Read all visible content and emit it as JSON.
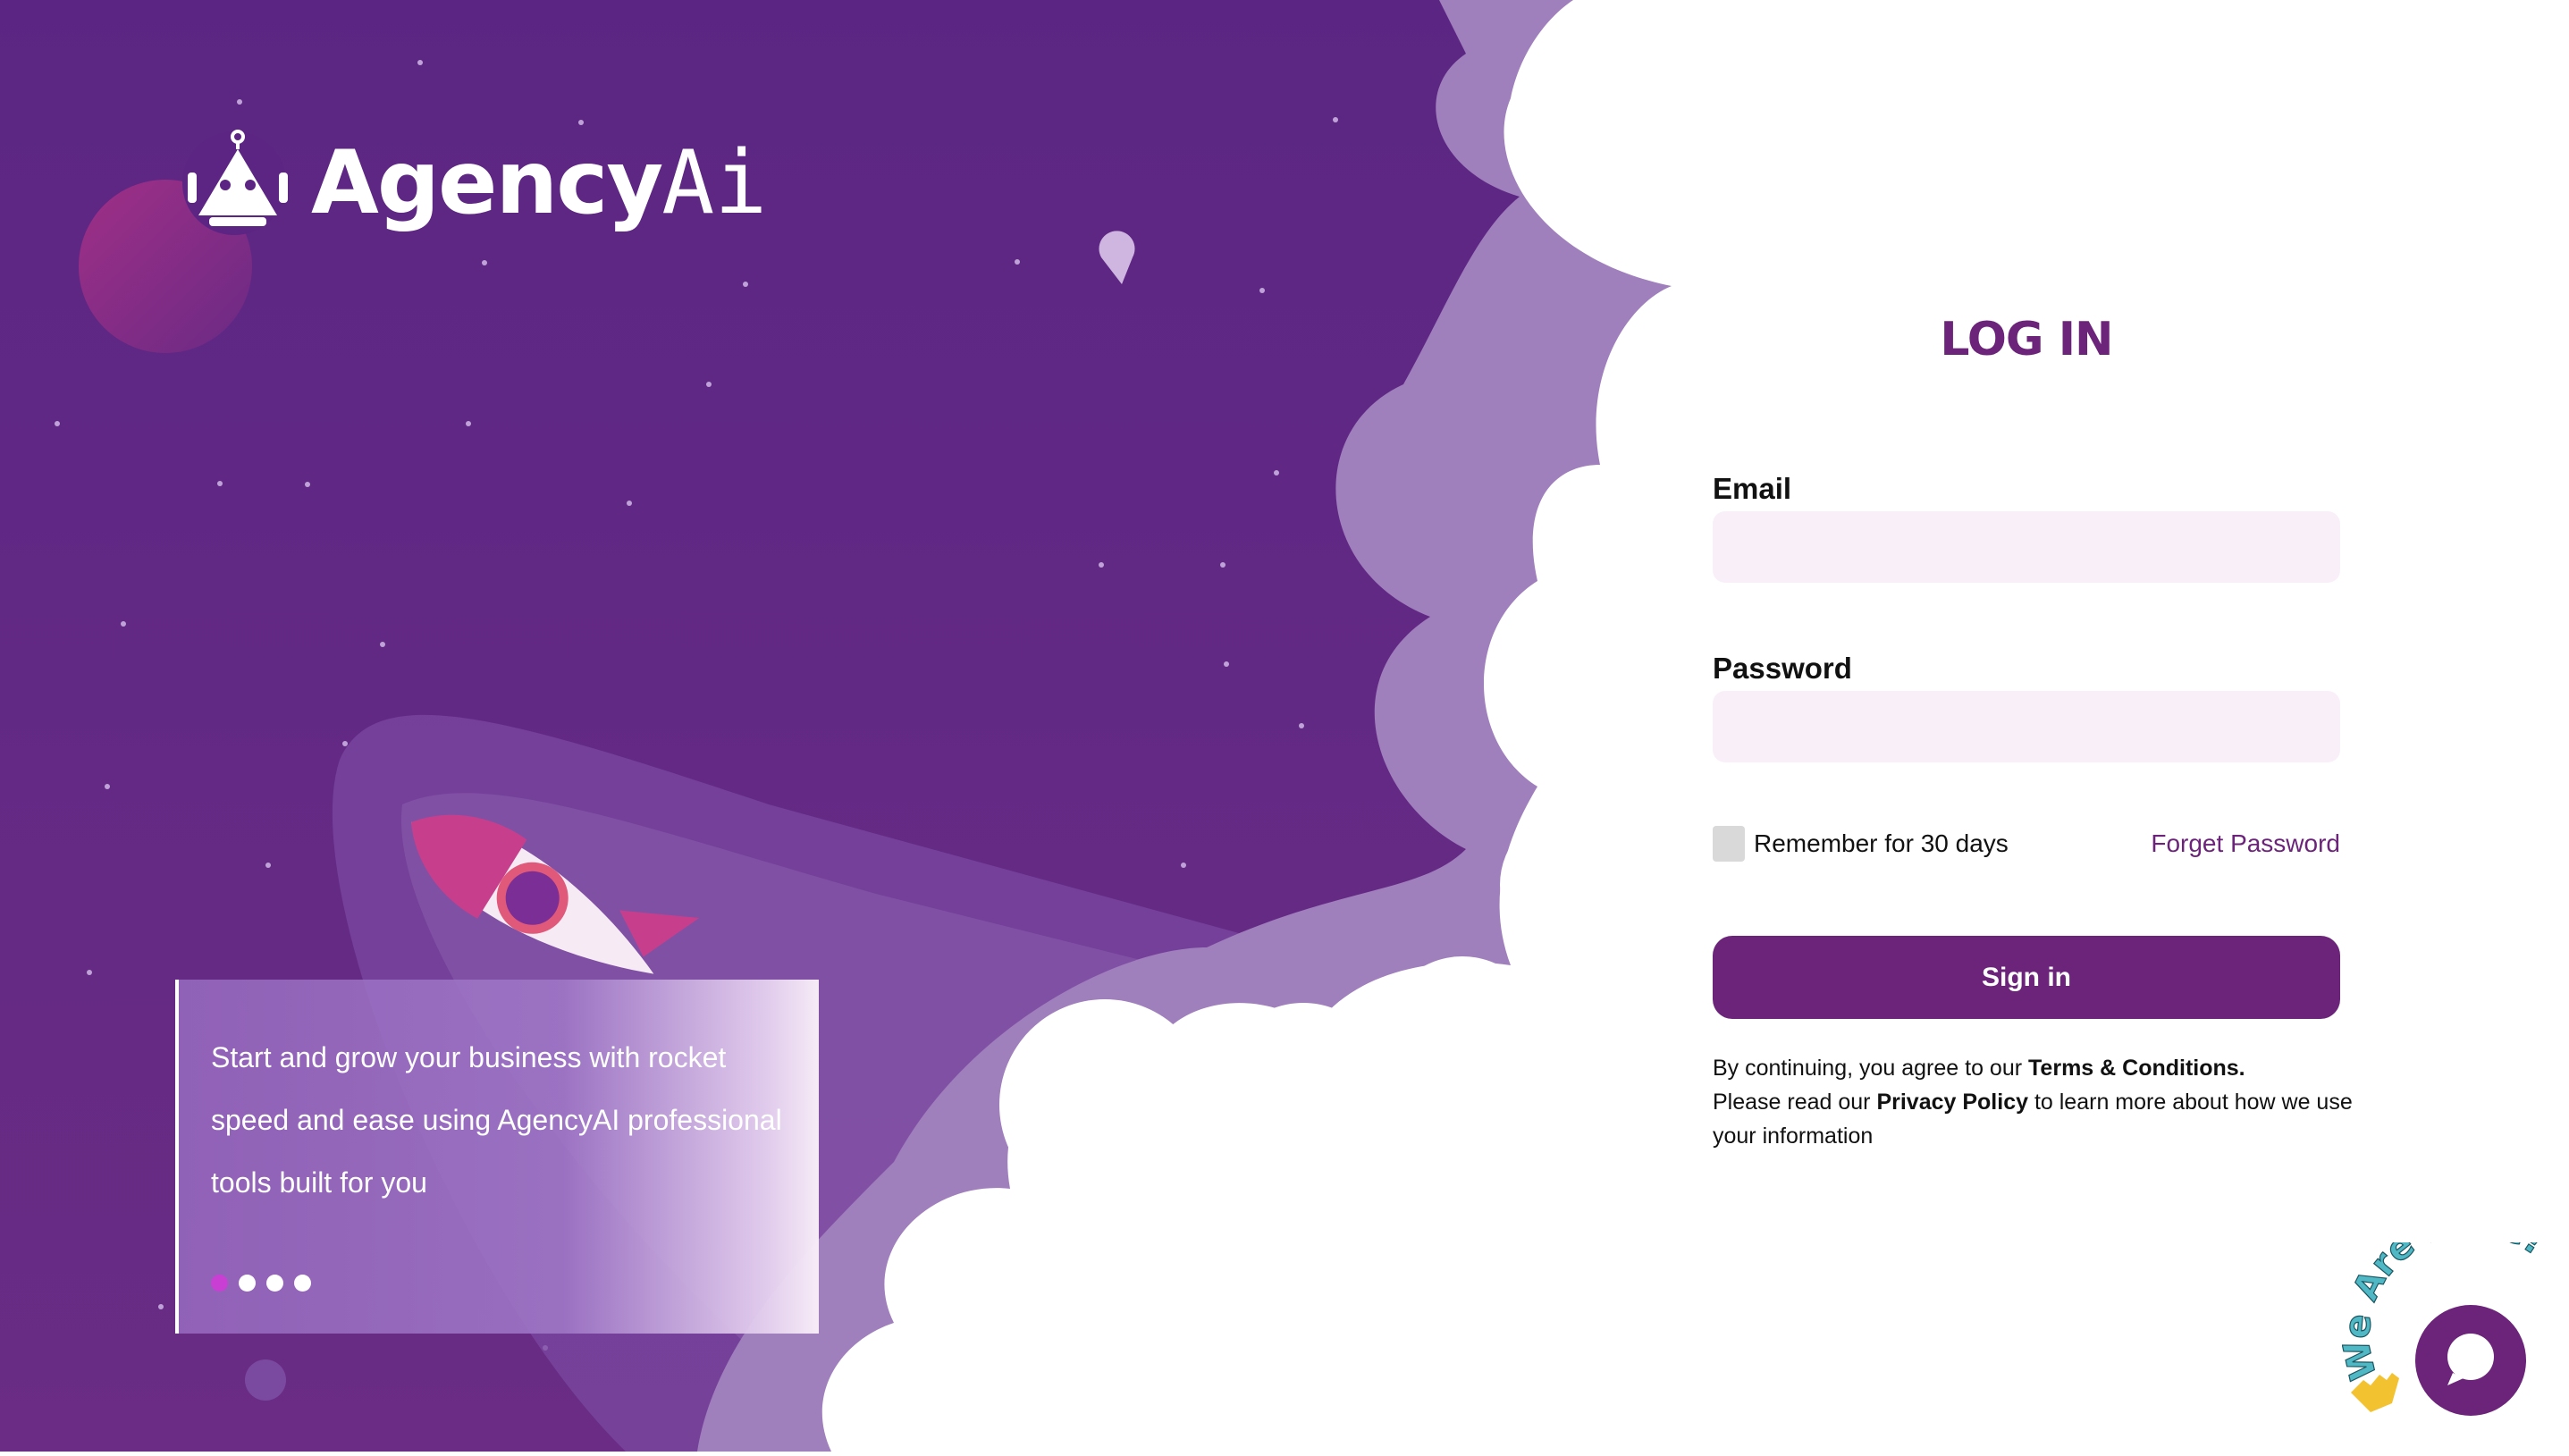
{
  "brand": {
    "name_primary": "Agency",
    "name_secondary": "Ai"
  },
  "promo": {
    "text": "Start and grow your business with rocket speed and ease using AgencyAI professional tools built for you",
    "dots": [
      true,
      false,
      false,
      false
    ]
  },
  "login": {
    "title": "LOG IN",
    "email_label": "Email",
    "email_value": "",
    "email_placeholder": "",
    "password_label": "Password",
    "password_value": "",
    "password_placeholder": "",
    "remember_label": "Remember for 30 days",
    "remember_checked": false,
    "forgot_label": "Forget Password",
    "signin_label": "Sign in",
    "terms_prefix": "By continuing, you agree to our ",
    "terms_link": "Terms & Conditions.",
    "privacy_prefix": "Please read our ",
    "privacy_link": "Privacy Policy",
    "privacy_suffix": " to learn more about how we use your information"
  },
  "help_widget": {
    "label": "We Are Here!",
    "icon": "chat-bubble-icon"
  },
  "colors": {
    "space_purple": "#5c2483",
    "brand_purple": "#6b2479",
    "cloud_lilac": "#a07fbd",
    "input_bg": "#f9eff8",
    "dot_active": "#c93fd3",
    "widget_teal": "#4fb8c4"
  }
}
